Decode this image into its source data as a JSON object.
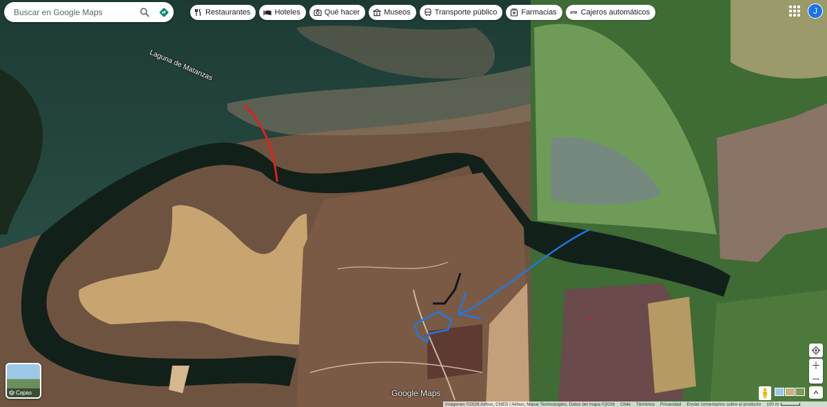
{
  "search": {
    "placeholder": "Buscar en Google Maps"
  },
  "chips": [
    {
      "label": "Restaurantes",
      "icon": "restaurant-icon"
    },
    {
      "label": "Hoteles",
      "icon": "hotel-icon"
    },
    {
      "label": "Qué hacer",
      "icon": "camera-icon"
    },
    {
      "label": "Museos",
      "icon": "museum-icon"
    },
    {
      "label": "Transporte público",
      "icon": "transit-icon"
    },
    {
      "label": "Farmacias",
      "icon": "pharmacy-icon"
    },
    {
      "label": "Cajeros automáticos",
      "icon": "atm-icon"
    }
  ],
  "account": {
    "initial": "J"
  },
  "map": {
    "lake_label": "Laguna de Matanzas",
    "logo": "Google Maps",
    "layers_label": "Capas"
  },
  "footer": {
    "imagery": "Imágenes ©2026 Airbus, CNES / Airbus, Maxar Technologies, Datos del mapa ©2026",
    "country": "Chile",
    "terms": "Términos",
    "privacy": "Privacidad",
    "feedback": "Enviar comentarios sobre el producto",
    "scale": "100 m"
  },
  "colors": {
    "accent": "#1a73e8",
    "annotation_red": "#e02020",
    "annotation_blue": "#1f78e0"
  }
}
